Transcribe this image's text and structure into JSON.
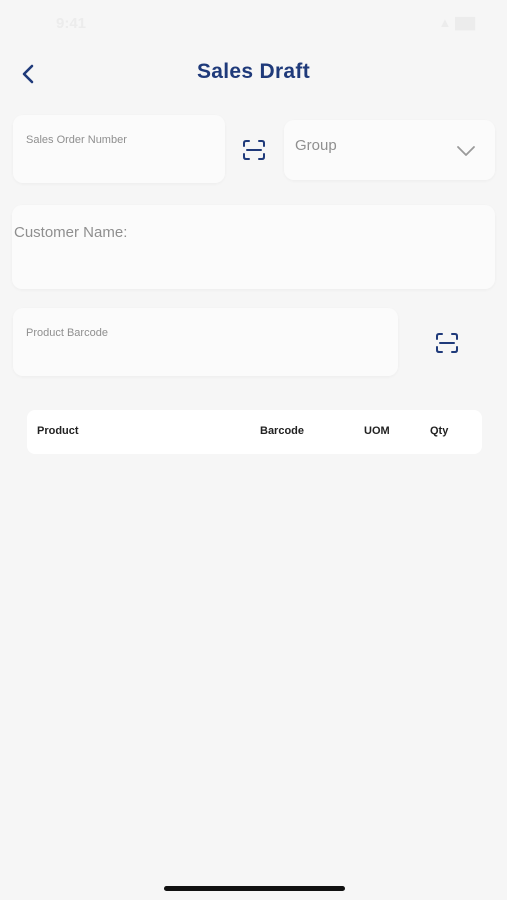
{
  "status_bar": {
    "time": "9:41",
    "indicators": "▲ ▇▇"
  },
  "header": {
    "title": "Sales Draft",
    "back_icon": "chevron-left-icon"
  },
  "form": {
    "sales_order_number_label": "Sales Order Number",
    "group_label": "Group",
    "customer_name_label": "Customer Name:",
    "product_barcode_label": "Product Barcode",
    "scan_icon": "barcode-scan-icon",
    "dropdown_icon": "chevron-down-icon"
  },
  "table": {
    "columns": [
      "Product",
      "Barcode",
      "UOM",
      "Qty"
    ]
  },
  "colors": {
    "accent": "#1f3a7a",
    "background": "#f6f6f6"
  }
}
